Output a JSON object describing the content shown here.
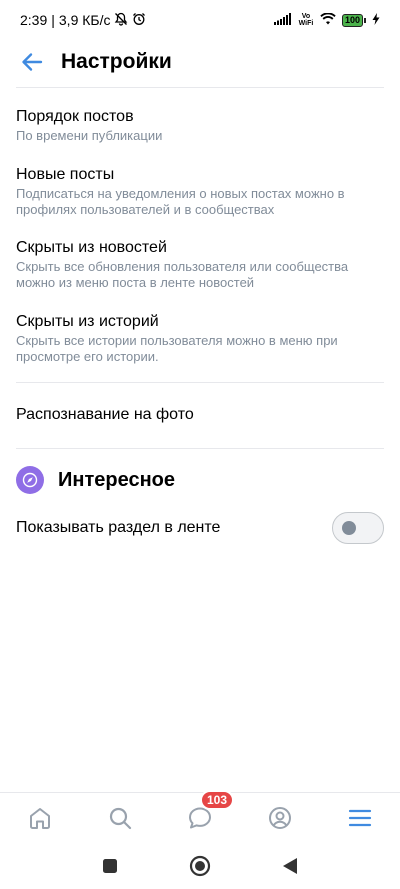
{
  "status_bar": {
    "time": "2:39",
    "network_speed": "3,9 КБ/с",
    "vowifi": "Vo WiFi",
    "battery": "100"
  },
  "header": {
    "title": "Настройки"
  },
  "settings": [
    {
      "title": "Порядок постов",
      "subtitle": "По времени публикации"
    },
    {
      "title": "Новые посты",
      "subtitle": "Подписаться на уведомления о новых постах можно в профилях пользователей и в сообществах"
    },
    {
      "title": "Скрыты из новостей",
      "subtitle": "Скрыть все обновления пользователя или сообщества можно из меню поста в ленте новостей"
    },
    {
      "title": "Скрыты из историй",
      "subtitle": "Скрыть все истории пользователя можно в меню при просмотре его истории."
    },
    {
      "title": "Распознавание на фото"
    }
  ],
  "interesting": {
    "title": "Интересное",
    "toggle_label": "Показывать раздел в ленте",
    "enabled": false
  },
  "bottom_nav": {
    "items": [
      "home-icon",
      "search-icon",
      "messages-icon",
      "profile-icon",
      "menu-icon"
    ],
    "messages_badge": "103"
  },
  "colors": {
    "accent": "#2a5885",
    "icon_blue": "#3f8ae0",
    "secondary_text": "#818c99",
    "badge": "#e64646",
    "section_icon": "#8f6ee6"
  }
}
